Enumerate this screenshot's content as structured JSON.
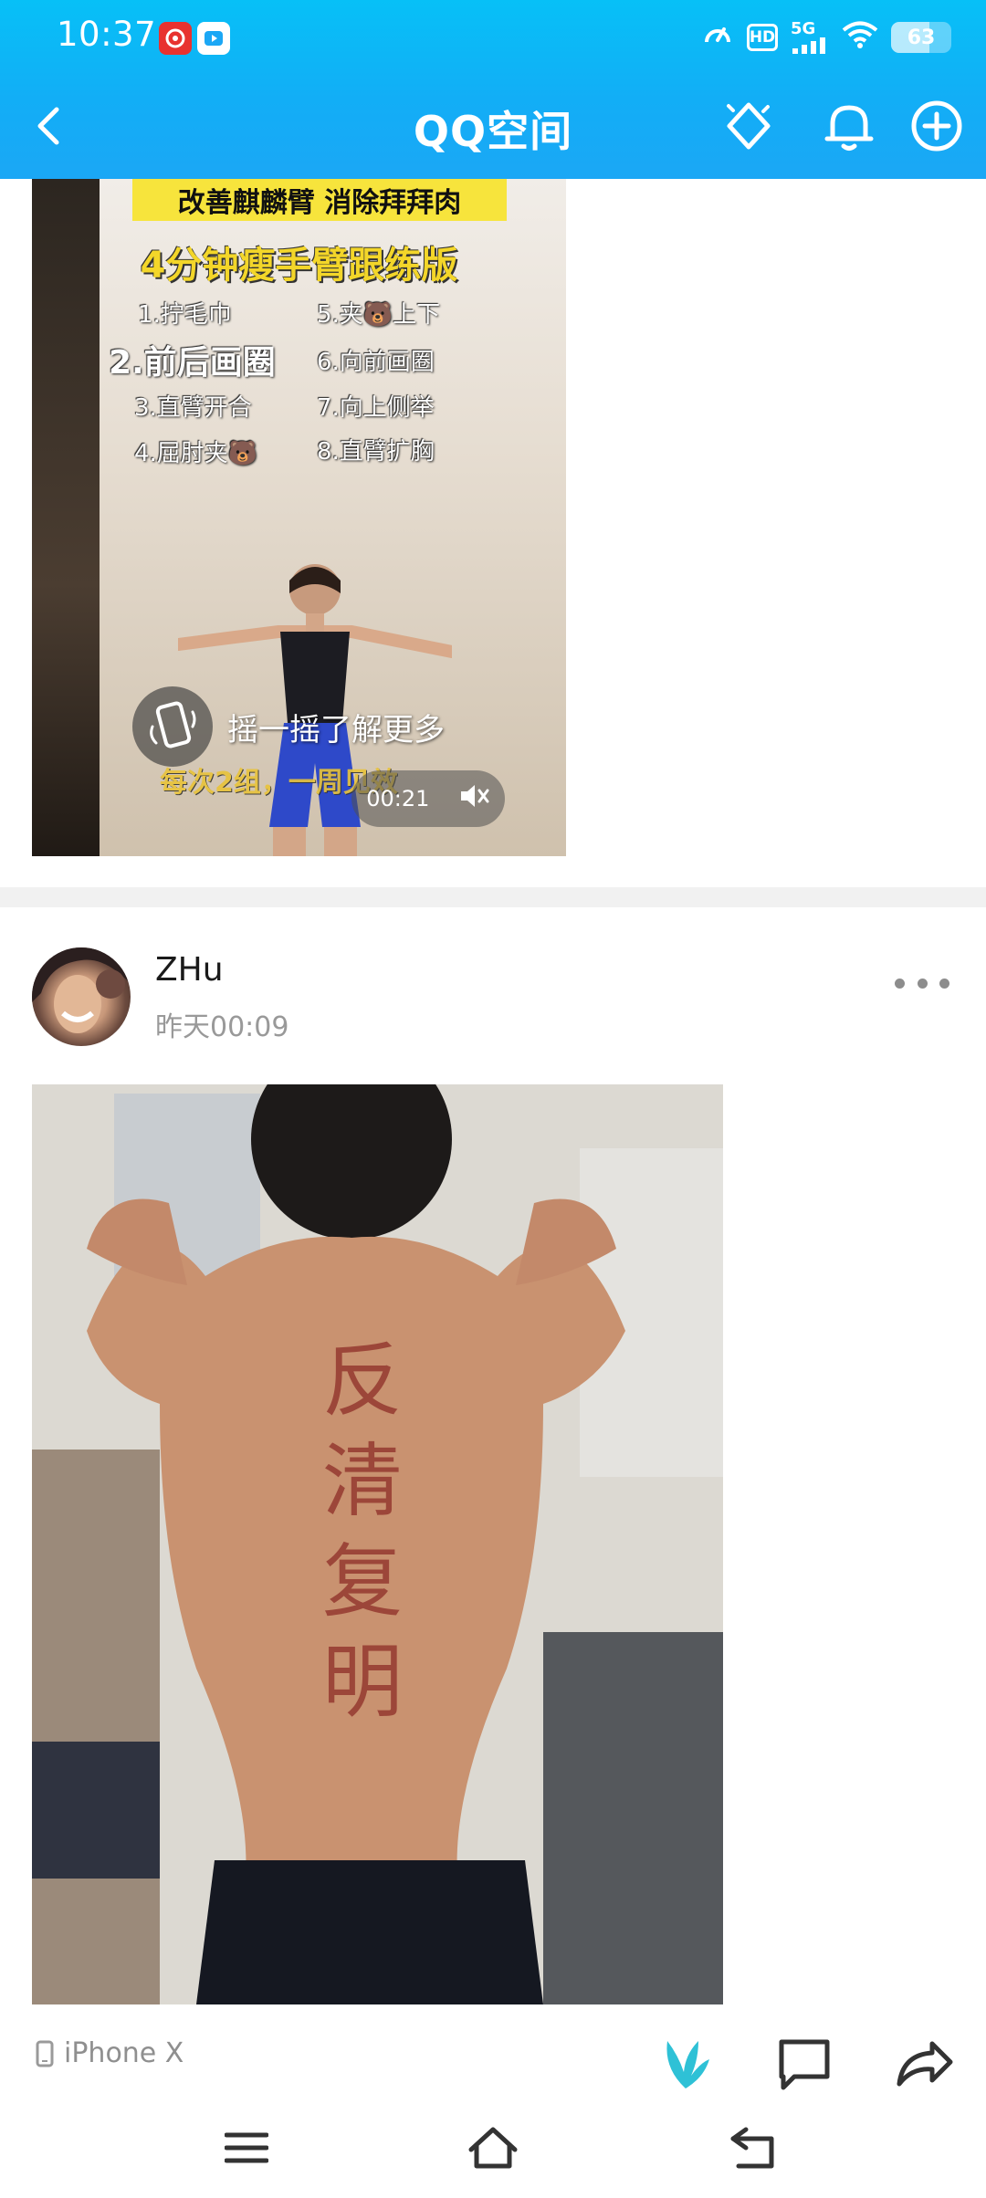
{
  "status_bar": {
    "time": "10:37",
    "network": "5G",
    "battery": "63",
    "battery_level": 0.63
  },
  "header": {
    "title": "QQ空间",
    "accent": "#12aef6"
  },
  "video_ad": {
    "banner": "改善麒麟臂 消除拜拜肉",
    "title": "4分钟瘦手臂跟练版",
    "steps": [
      "1.拧毛巾",
      "2.前后画圈",
      "3.直臂开合",
      "4.屈肘夹🐻",
      "5.夹🐻上下",
      "6.向前画圈",
      "7.向上侧举",
      "8.直臂扩胸"
    ],
    "shake_text": "摇一摇了解更多",
    "subtitle": "每次2组，一周见效",
    "duration": "00:21"
  },
  "post": {
    "username": "ZHu",
    "time": "昨天00:09",
    "photo_caption": "反清复明",
    "device": "iPhone X"
  }
}
